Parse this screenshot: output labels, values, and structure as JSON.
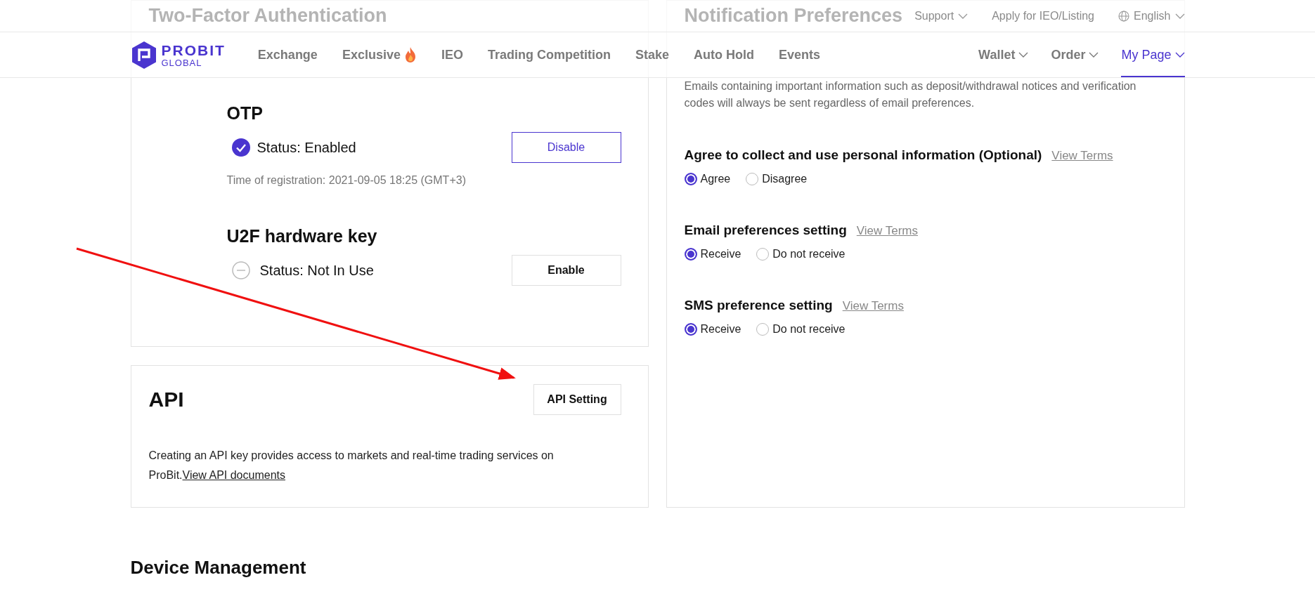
{
  "top_bar": {
    "items": [
      {
        "label": "Support",
        "dropdown": true,
        "globe": false
      },
      {
        "label": "Apply for IEO/Listing",
        "dropdown": false,
        "globe": false
      },
      {
        "label": "English",
        "dropdown": true,
        "globe": true
      }
    ]
  },
  "nav": {
    "logo": {
      "name": "PROBIT",
      "sub": "GLOBAL"
    },
    "left": [
      {
        "label": "Exchange",
        "hot": false,
        "dropdown": false,
        "selected": false
      },
      {
        "label": "Exclusive",
        "hot": true,
        "dropdown": false,
        "selected": false
      },
      {
        "label": "IEO",
        "hot": false,
        "dropdown": false,
        "selected": false
      },
      {
        "label": "Trading Competition",
        "hot": false,
        "dropdown": false,
        "selected": false
      },
      {
        "label": "Stake",
        "hot": false,
        "dropdown": false,
        "selected": false
      },
      {
        "label": "Auto Hold",
        "hot": false,
        "dropdown": false,
        "selected": false
      },
      {
        "label": "Events",
        "hot": false,
        "dropdown": false,
        "selected": false
      }
    ],
    "right": [
      {
        "label": "Wallet",
        "hot": false,
        "dropdown": true,
        "selected": false
      },
      {
        "label": "Order",
        "hot": false,
        "dropdown": true,
        "selected": false
      },
      {
        "label": "My Page",
        "hot": false,
        "dropdown": true,
        "selected": true
      }
    ]
  },
  "two_factor": {
    "title": "Two-Factor Authentication",
    "methods": [
      {
        "name": "OTP",
        "enabled": true,
        "status": "Status: Enabled",
        "button": "Disable",
        "registration": "Time of registration: 2021-09-05 18:25 (GMT+3)"
      },
      {
        "name": "U2F hardware key",
        "enabled": false,
        "status": "Status: Not In Use",
        "button": "Enable"
      }
    ]
  },
  "api": {
    "title": "API",
    "button": "API Setting",
    "description": "Creating an API key provides access to markets and real-time trading services on ProBit.",
    "link": "View API documents"
  },
  "notifications": {
    "title": "Notification Preferences",
    "description": "Emails containing important information such as deposit/withdrawal notices and verification codes will always be sent regardless of email preferences.",
    "groups": [
      {
        "title": "Agree to collect and use personal information (Optional)",
        "link": "View Terms",
        "options": [
          {
            "label": "Agree",
            "selected": true
          },
          {
            "label": "Disagree",
            "selected": false
          }
        ]
      },
      {
        "title": "Email preferences setting",
        "link": "View Terms",
        "options": [
          {
            "label": "Receive",
            "selected": true
          },
          {
            "label": "Do not receive",
            "selected": false
          }
        ]
      },
      {
        "title": "SMS preference setting",
        "link": "View Terms",
        "options": [
          {
            "label": "Receive",
            "selected": true
          },
          {
            "label": "Do not receive",
            "selected": false
          }
        ]
      }
    ]
  },
  "device_management": {
    "title": "Device Management"
  }
}
